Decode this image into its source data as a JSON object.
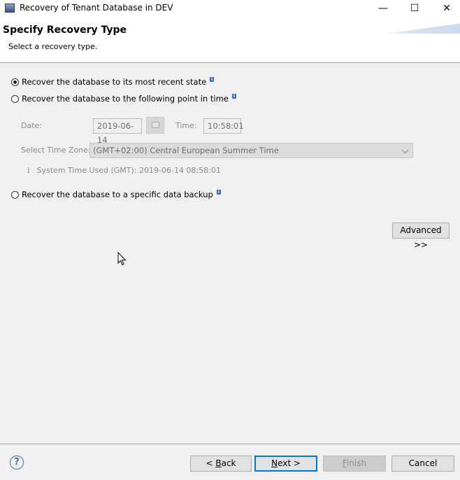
{
  "window": {
    "title": "Recovery of Tenant Database in DEV",
    "minimize_glyph": "—",
    "maximize_glyph": "☐",
    "close_glyph": "✕"
  },
  "header": {
    "title": "Specify Recovery Type",
    "subtitle": "Select a recovery type."
  },
  "options": {
    "most_recent": {
      "label": "Recover the database to its most recent state",
      "checked": true
    },
    "point_in_time": {
      "label": "Recover the database to the following point in time",
      "checked": false
    },
    "data_backup": {
      "label": "Recover the database to a specific data backup",
      "checked": false
    },
    "info_glyph": "i"
  },
  "point_in_time": {
    "date_label": "Date:",
    "date_value": "2019-06-14",
    "time_label": "Time:",
    "time_value": "10:58:01",
    "timezone_label": "Select Time Zone:",
    "timezone_value": "(GMT+02:00) Central European Summer Time",
    "system_time_glyph": "i",
    "system_time_text": "System Time Used (GMT): 2019-06-14 08:58:01"
  },
  "advanced_button": "Advanced >>",
  "footer": {
    "help_glyph": "?",
    "back": {
      "prefix": "< ",
      "key": "B",
      "rest": "ack"
    },
    "next": {
      "key": "N",
      "rest": "ext >"
    },
    "finish": {
      "key": "F",
      "rest": "inish"
    },
    "cancel": "Cancel"
  },
  "colors": {
    "accent": "#0078d7",
    "info_icon": "#3a6fb5",
    "disabled_text": "#8a8a8a"
  }
}
